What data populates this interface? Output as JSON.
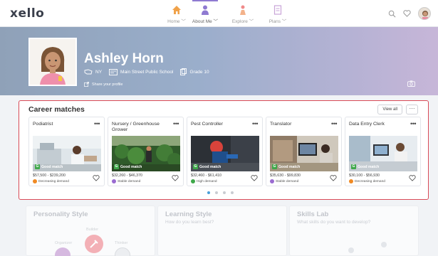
{
  "app": {
    "logo": "xello"
  },
  "nav": {
    "items": [
      {
        "label": "Home",
        "icon": "house-icon"
      },
      {
        "label": "About Me",
        "icon": "person-icon"
      },
      {
        "label": "Explore",
        "icon": "explore-person-icon"
      },
      {
        "label": "Plans",
        "icon": "clipboard-icon"
      }
    ],
    "active": "About Me"
  },
  "profile": {
    "name": "Ashley Horn",
    "location": "NY",
    "school": "Main Street Public School",
    "grade": "Grade 10",
    "share_label": "Share your profile"
  },
  "career_matches": {
    "title": "Career matches",
    "view_all": "View all",
    "more": "···",
    "cards": [
      {
        "title": "Podiatrist",
        "match": "Good match",
        "salary": "$57,500 - $239,200",
        "demand": "Decreasing demand",
        "demand_color": "#f08a24"
      },
      {
        "title": "Nursery / Greenhouse Grower",
        "match": "Good match",
        "salary": "$32,260 - $46,370",
        "demand": "Stable demand",
        "demand_color": "#9a6bd1"
      },
      {
        "title": "Pest Controller",
        "match": "Good match",
        "salary": "$32,460 - $61,410",
        "demand": "High demand",
        "demand_color": "#3fa84a"
      },
      {
        "title": "Translator",
        "match": "Good match",
        "salary": "$35,630 - $99,830",
        "demand": "Stable demand",
        "demand_color": "#9a6bd1"
      },
      {
        "title": "Data Entry Clerk",
        "match": "Good match",
        "salary": "$30,100 - $56,930",
        "demand": "Decreasing demand",
        "demand_color": "#f08a24"
      }
    ],
    "pager_count": 4,
    "pager_active": 0
  },
  "bottom_panels": {
    "personality": {
      "title": "Personality Style",
      "labels": [
        "Builder",
        "Organizer",
        "Thinker"
      ]
    },
    "learning": {
      "title": "Learning Style",
      "subtitle": "How do you learn best?"
    },
    "skills": {
      "title": "Skills Lab",
      "subtitle": "What skills do you want to develop?"
    }
  },
  "colors": {
    "accent": "#8f7ad1",
    "highlight_border": "#d94a57",
    "good_match": "#3fa84a",
    "pager_active": "#4a9fd9"
  }
}
